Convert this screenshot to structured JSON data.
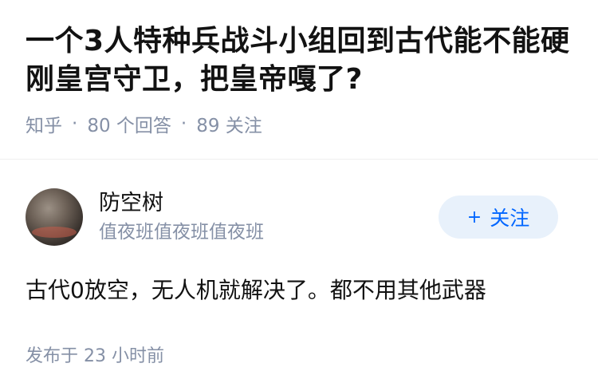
{
  "question": {
    "title": "一个3人特种兵战斗小组回到古代能不能硬刚皇宫守卫，把皇帝嘎了?",
    "source": "知乎",
    "separator": "·",
    "answers_count": "80 个回答",
    "followers_count": "89 关注"
  },
  "answer": {
    "author_name": "防空树",
    "author_bio": "值夜班值夜班值夜班",
    "follow_label": "关注",
    "follow_icon": "plus-icon",
    "content": "古代0放空，无人机就解决了。都不用其他武器",
    "published": "发布于 23 小时前"
  },
  "colors": {
    "accent": "#0066ff",
    "follow_bg": "#e8f1fb",
    "meta": "#8590a6"
  }
}
